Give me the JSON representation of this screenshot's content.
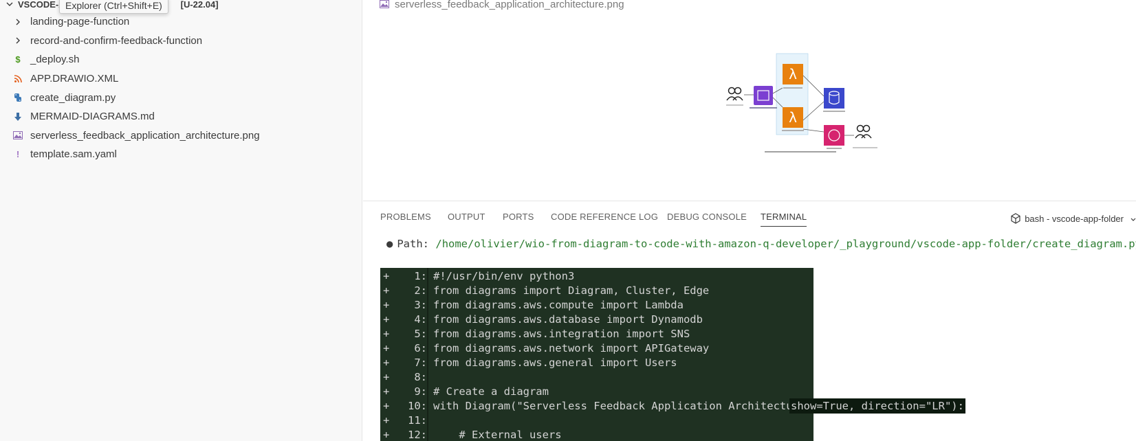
{
  "sidebar": {
    "folder_name_start": "VSCODE-A",
    "folder_name_end": "[U-22.04]",
    "tooltip": "Explorer (Ctrl+Shift+E)",
    "items": [
      {
        "label": "landing-page-function",
        "icon": "chevron-right-icon"
      },
      {
        "label": "record-and-confirm-feedback-function",
        "icon": "chevron-right-icon"
      },
      {
        "label": "_deploy.sh",
        "icon": "dollar-icon"
      },
      {
        "label": "APP.DRAWIO.XML",
        "icon": "rss-icon"
      },
      {
        "label": "create_diagram.py",
        "icon": "python-icon"
      },
      {
        "label": "MERMAID-DIAGRAMS.md",
        "icon": "download-arrow-icon"
      },
      {
        "label": "serverless_feedback_application_architecture.png",
        "icon": "image-icon"
      },
      {
        "label": "template.sam.yaml",
        "icon": "exclamation-icon"
      }
    ]
  },
  "editor": {
    "image_title": "serverless_feedback_application_architecture.png",
    "colors": {
      "lambda": "#e8810e",
      "apigw": "#7b3fd1",
      "dynamo": "#3b48cc",
      "sns": "#d6246f",
      "cluster": "#e6f3fb"
    }
  },
  "panel": {
    "tabs": [
      "PROBLEMS",
      "OUTPUT",
      "PORTS",
      "CODE REFERENCE LOG",
      "DEBUG CONSOLE",
      "TERMINAL"
    ],
    "active_tab": "TERMINAL",
    "terminal_name": "bash - vscode-app-folder",
    "path_label": "Path:",
    "path_value": "/home/olivier/wio-from-diagram-to-code-with-amazon-q-developer/_playground/vscode-app-folder/create_diagram.py",
    "diff_lines": [
      {
        "num": "1:",
        "code": "#!/usr/bin/env python3"
      },
      {
        "num": "2:",
        "code": "from diagrams import Diagram, Cluster, Edge"
      },
      {
        "num": "3:",
        "code": "from diagrams.aws.compute import Lambda"
      },
      {
        "num": "4:",
        "code": "from diagrams.aws.database import Dynamodb"
      },
      {
        "num": "5:",
        "code": "from diagrams.aws.integration import SNS"
      },
      {
        "num": "6:",
        "code": "from diagrams.aws.network import APIGateway"
      },
      {
        "num": "7:",
        "code": "from diagrams.aws.general import Users"
      },
      {
        "num": "8:",
        "code": ""
      },
      {
        "num": "9:",
        "code": "# Create a diagram"
      },
      {
        "num": "10:",
        "code": "with Diagram(\"Serverless Feedback Application Architecture\", ",
        "selected": "show=True, direction=\"LR\"):"
      },
      {
        "num": "11:",
        "code": ""
      },
      {
        "num": "12:",
        "code": "    # External users"
      }
    ],
    "diff_colors": {
      "bg": "#1f3122",
      "text": "#d4d4d4",
      "path": "#2e7d32"
    }
  }
}
